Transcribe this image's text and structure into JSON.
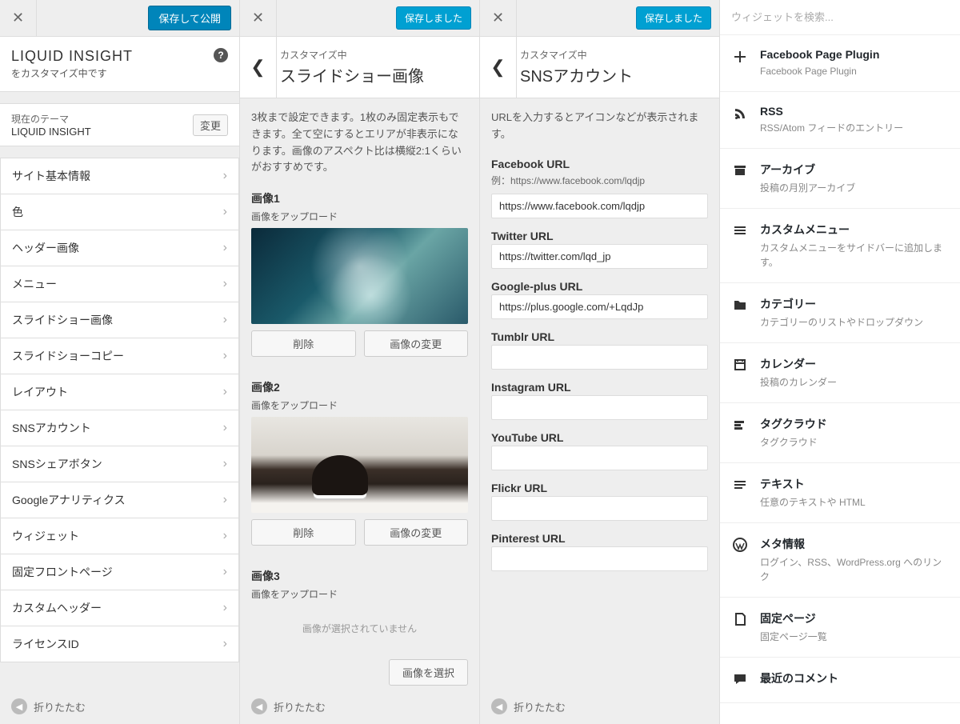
{
  "panel1": {
    "save_btn": "保存して公開",
    "site_title": "LIQUID INSIGHT",
    "site_sub": "をカスタマイズ中です",
    "theme_label": "現在のテーマ",
    "theme_name": "LIQUID INSIGHT",
    "change_btn": "変更",
    "menu": [
      "サイト基本情報",
      "色",
      "ヘッダー画像",
      "メニュー",
      "スライドショー画像",
      "スライドショーコピー",
      "レイアウト",
      "SNSアカウント",
      "SNSシェアボタン",
      "Googleアナリティクス",
      "ウィジェット",
      "固定フロントページ",
      "カスタムヘッダー",
      "ライセンスID"
    ],
    "collapse": "折りたたむ"
  },
  "panel2": {
    "saved_btn": "保存しました",
    "breadcrumb": "カスタマイズ中",
    "title": "スライドショー画像",
    "description": "3枚まで設定できます。1枚のみ固定表示もできます。全て空にするとエリアが非表示になります。画像のアスペクト比は横縦2:1くらいがおすすめです。",
    "img1_label": "画像1",
    "upload_label": "画像をアップロード",
    "delete_btn": "削除",
    "change_img_btn": "画像の変更",
    "img2_label": "画像2",
    "img3_label": "画像3",
    "no_image": "画像が選択されていません",
    "select_img_btn": "画像を選択",
    "collapse": "折りたたむ"
  },
  "panel3": {
    "saved_btn": "保存しました",
    "breadcrumb": "カスタマイズ中",
    "title": "SNSアカウント",
    "description": "URLを入力するとアイコンなどが表示されます。",
    "facebook_label": "Facebook URL",
    "facebook_example": "例：https://www.facebook.com/lqdjp",
    "facebook_value": "https://www.facebook.com/lqdjp",
    "twitter_label": "Twitter URL",
    "twitter_value": "https://twitter.com/lqd_jp",
    "gplus_label": "Google-plus URL",
    "gplus_value": "https://plus.google.com/+LqdJp",
    "tumblr_label": "Tumblr URL",
    "tumblr_value": "",
    "instagram_label": "Instagram URL",
    "instagram_value": "",
    "youtube_label": "YouTube URL",
    "youtube_value": "",
    "flickr_label": "Flickr URL",
    "flickr_value": "",
    "pinterest_label": "Pinterest URL",
    "pinterest_value": "",
    "collapse": "折りたたむ"
  },
  "panel4": {
    "search_placeholder": "ウィジェットを検索...",
    "widgets": [
      {
        "icon": "plus",
        "title": "Facebook Page Plugin",
        "desc": "Facebook Page Plugin"
      },
      {
        "icon": "rss",
        "title": "RSS",
        "desc": "RSS/Atom フィードのエントリー"
      },
      {
        "icon": "archive",
        "title": "アーカイブ",
        "desc": "投稿の月別アーカイブ"
      },
      {
        "icon": "menu",
        "title": "カスタムメニュー",
        "desc": "カスタムメニューをサイドバーに追加します。"
      },
      {
        "icon": "folder",
        "title": "カテゴリー",
        "desc": "カテゴリーのリストやドロップダウン"
      },
      {
        "icon": "calendar",
        "title": "カレンダー",
        "desc": "投稿のカレンダー"
      },
      {
        "icon": "tag",
        "title": "タグクラウド",
        "desc": "タグクラウド"
      },
      {
        "icon": "text",
        "title": "テキスト",
        "desc": "任意のテキストや HTML"
      },
      {
        "icon": "wp",
        "title": "メタ情報",
        "desc": "ログイン、RSS、WordPress.org へのリンク"
      },
      {
        "icon": "page",
        "title": "固定ページ",
        "desc": "固定ページ一覧"
      },
      {
        "icon": "comment",
        "title": "最近のコメント",
        "desc": ""
      }
    ]
  }
}
